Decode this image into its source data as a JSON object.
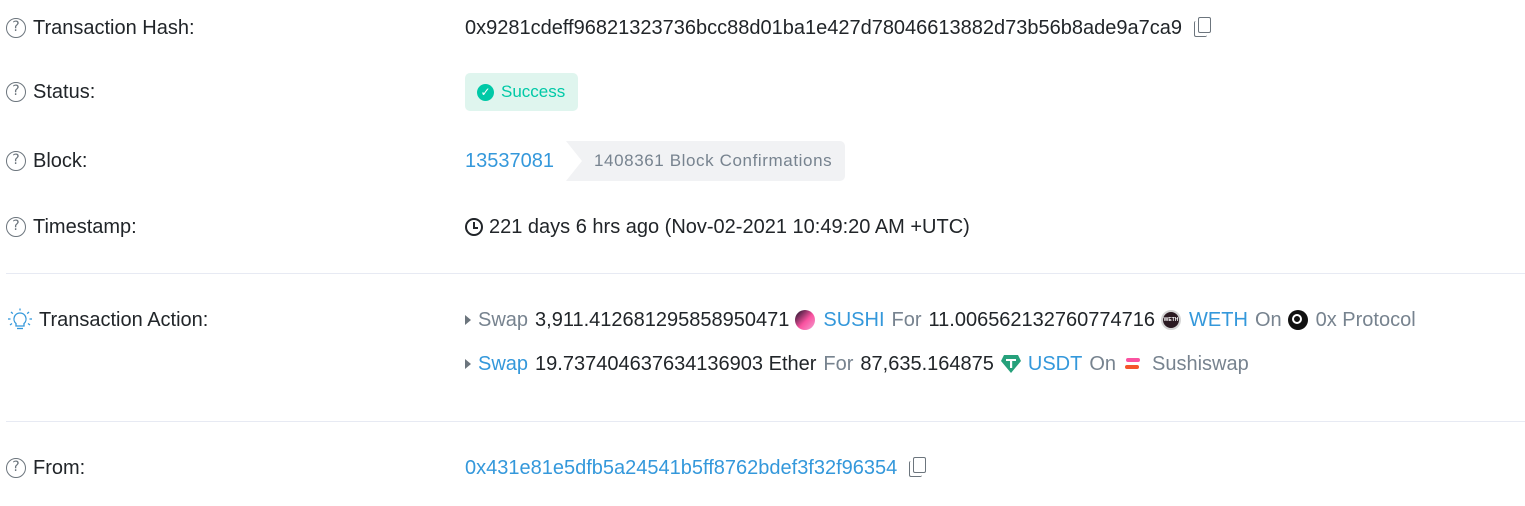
{
  "tx_hash": {
    "label": "Transaction Hash:",
    "value": "0x9281cdeff96821323736bcc88d01ba1e427d78046613882d73b56b8ade9a7ca9"
  },
  "status": {
    "label": "Status:",
    "value": "Success",
    "color": "#00c9a7"
  },
  "block": {
    "label": "Block:",
    "number": "13537081",
    "confirmations": "1408361 Block Confirmations"
  },
  "timestamp": {
    "label": "Timestamp:",
    "value": "221 days 6 hrs ago (Nov-02-2021 10:49:20 AM +UTC)"
  },
  "transaction_action": {
    "label": "Transaction Action:",
    "actions": [
      {
        "verb": "Swap",
        "amount_in": "3,911.412681295858950471",
        "token_in": "SUSHI",
        "for_word": "For",
        "amount_out": "11.006562132760774716",
        "token_out": "WETH",
        "on_word": "On",
        "protocol": "0x Protocol"
      },
      {
        "verb": "Swap",
        "amount_in": "19.737404637634136903 Ether",
        "token_in": "",
        "for_word": "For",
        "amount_out": "87,635.164875",
        "token_out": "USDT",
        "on_word": "On",
        "protocol": "Sushiswap"
      }
    ]
  },
  "from": {
    "label": "From:",
    "address": "0x431e81e5dfb5a24541b5ff8762bdef3f32f96354"
  },
  "icons": {
    "help": "question-circle-icon",
    "copy": "copy-icon",
    "clock": "clock-icon",
    "bulb": "lightbulb-icon",
    "check": "check-circle-icon"
  },
  "colors": {
    "link": "#3498db",
    "muted": "#77838f",
    "success_bg": "#dff5ee",
    "success_fg": "#00c9a7"
  }
}
